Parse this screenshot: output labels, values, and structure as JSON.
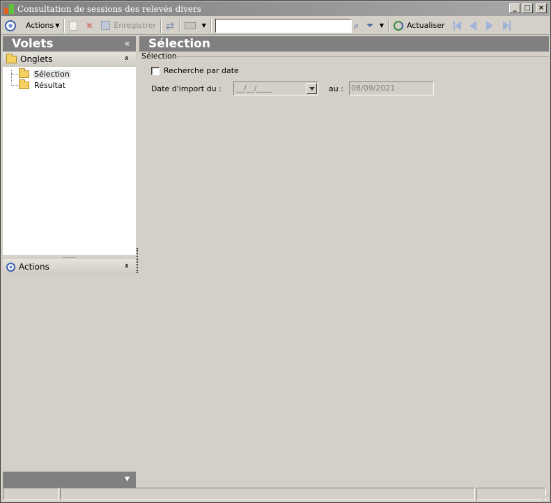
{
  "window": {
    "title": "Consultation de sessions des relevés divers",
    "minimize": "_",
    "maximize": "□",
    "close": "×"
  },
  "toolbar": {
    "actions_label": "Actions",
    "save_label": "Enregistrer",
    "search_value": "",
    "refresh_label": "Actualiser"
  },
  "left_pane": {
    "title": "Volets",
    "collapse": "«",
    "onglets_label": "Onglets",
    "onglets_chevron": "»",
    "tree": [
      {
        "label": "Sélection",
        "selected": true
      },
      {
        "label": "Résultat",
        "selected": false
      }
    ],
    "splitter": "........",
    "actions_label": "Actions",
    "actions_chevron": "»",
    "bottom_arrow": "▼"
  },
  "main": {
    "title": "Sélection",
    "group_legend": "Sélection",
    "checkbox_label": "Recherche par date",
    "checkbox_checked": false,
    "date_from_label": "Date d'import du :",
    "date_from_value": "__/__/____",
    "date_to_label": "au :",
    "date_to_value": "08/09/2021"
  },
  "status": {
    "grip": "⋰"
  },
  "colors": {
    "header_bg": "#808080",
    "window_bg": "#d4d0c8",
    "icon_blue": "#3a5ea8"
  }
}
